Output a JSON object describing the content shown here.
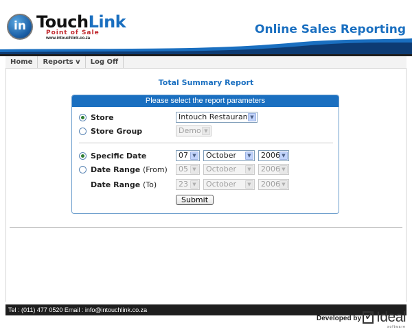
{
  "colors": {
    "brand_blue": "#1a6fc0",
    "header_dark": "#1e1e1e",
    "radio_selected": "#2e7d32"
  },
  "header": {
    "logo": {
      "badge": "in",
      "word_a": "Touch",
      "word_b": "Link",
      "tagline": "Point of Sale",
      "url": "www.intouchlink.co.za"
    },
    "app_title": "Online Sales Reporting"
  },
  "menu": {
    "items": [
      "Home",
      "Reports v",
      "Log Off"
    ]
  },
  "report": {
    "title": "Total Summary Report",
    "panel_heading": "Please select the report parameters",
    "store": {
      "label": "Store",
      "value": "Intouch Restaurant",
      "selected": true
    },
    "store_group": {
      "label": "Store Group",
      "value": "Demo",
      "selected": false
    },
    "specific_date": {
      "label": "Specific Date",
      "day": "07",
      "month": "October",
      "year": "2006",
      "selected": true
    },
    "range_from": {
      "label": "Date Range",
      "sub": "(From)",
      "day": "05",
      "month": "October",
      "year": "2006",
      "selected": false
    },
    "range_to": {
      "label": "Date Range",
      "sub": "(To)",
      "day": "23",
      "month": "October",
      "year": "2006"
    },
    "submit_label": "Submit"
  },
  "footer": {
    "contact": "Tel : (011) 477 0520 Email : info@intouchlink.co.za",
    "developed_by": "Developed by",
    "dev_logo": {
      "word": "Ideal",
      "sub": "software",
      "icon": "checkbox-icon"
    }
  }
}
